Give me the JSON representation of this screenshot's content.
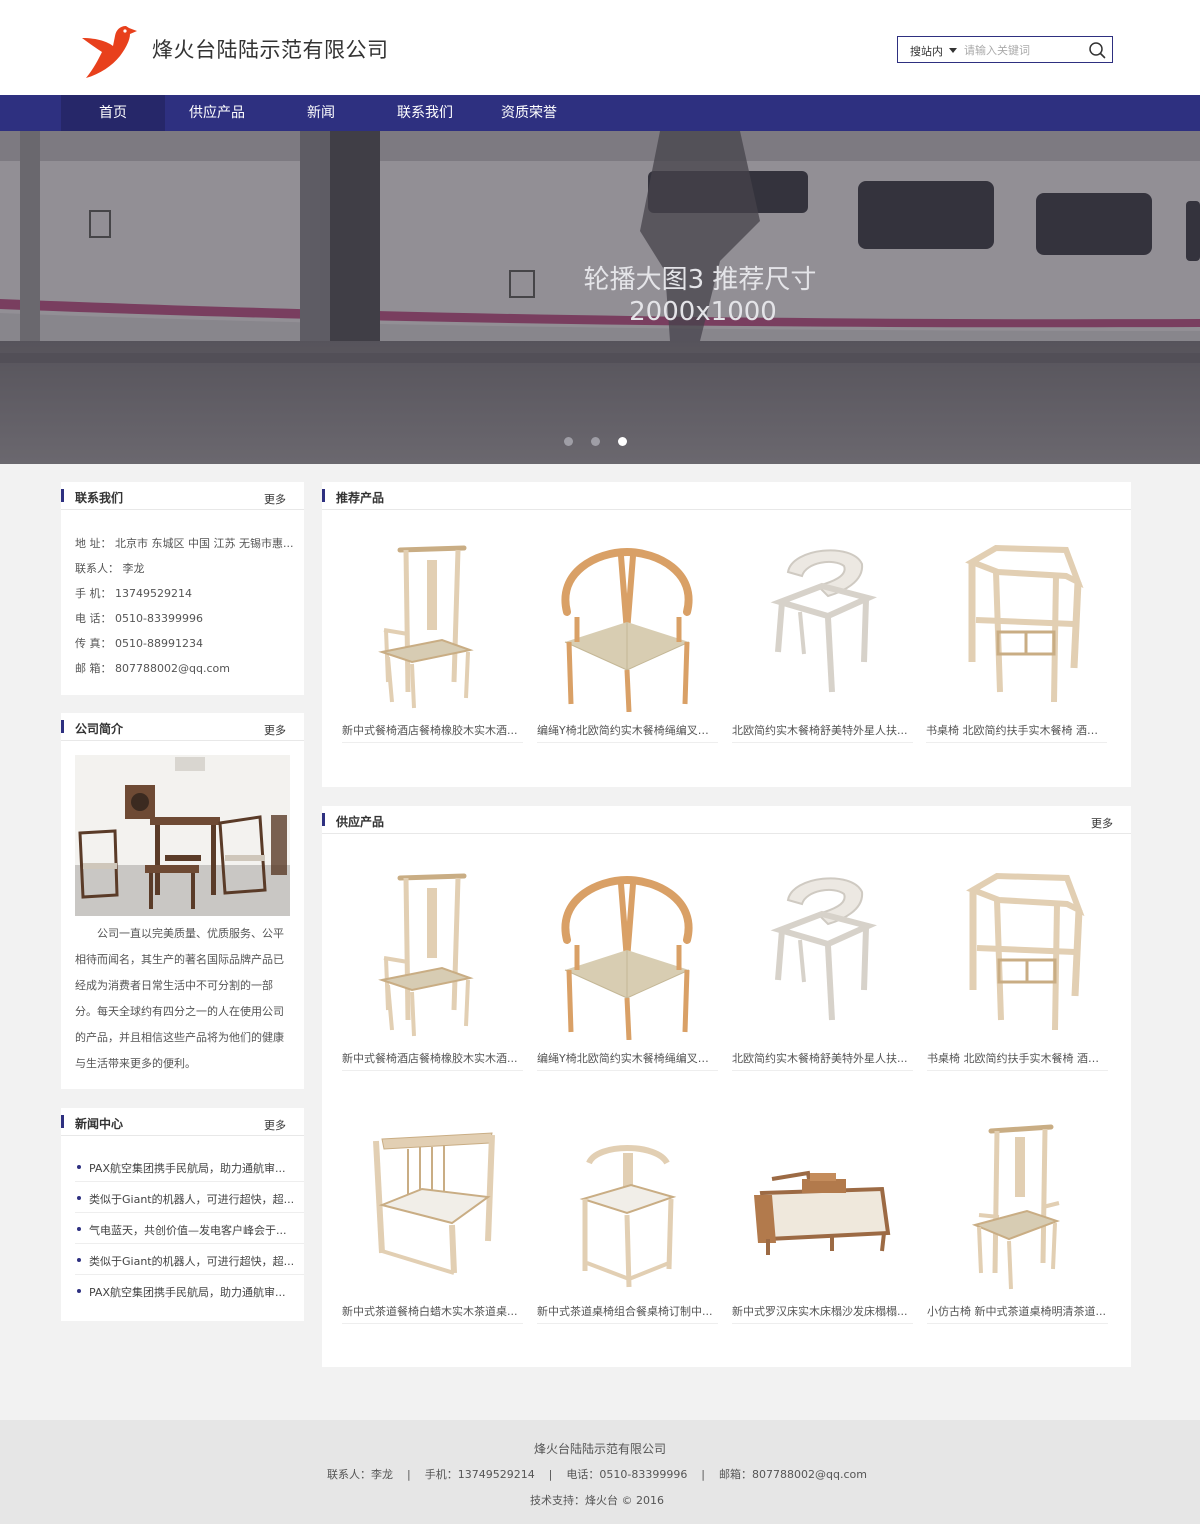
{
  "header": {
    "company_name": "烽火台陆陆示范有限公司",
    "search": {
      "scope": "搜站内",
      "placeholder": "请输入关键词"
    }
  },
  "nav": {
    "items": [
      {
        "label": "首页"
      },
      {
        "label": "供应产品"
      },
      {
        "label": "新闻"
      },
      {
        "label": "联系我们"
      },
      {
        "label": "资质荣誉"
      }
    ]
  },
  "banner": {
    "title": "轮播大图3  推荐尺寸",
    "subtitle": "2000x1000",
    "slide_count": 3,
    "active_slide": 3
  },
  "contact": {
    "title": "联系我们",
    "more": "更多",
    "lines": [
      "地 址： 北京市 东城区 中国 江苏 无锡市惠...",
      "联系人： 李龙",
      "手 机： 13749529214",
      "电 话： 0510-83399996",
      "传 真： 0510-88991234",
      "邮 箱： 807788002@qq.com"
    ]
  },
  "intro": {
    "title": "公司简介",
    "more": "更多",
    "text": "公司一直以完美质量、优质服务、公平相待而闻名，其生产的著名国际品牌产品已经成为消费者日常生活中不可分割的一部分。每天全球约有四分之一的人在使用公司的产品，并且相信这些产品将为他们的健康与生活带来更多的便利。"
  },
  "news": {
    "title": "新闻中心",
    "more": "更多",
    "items": [
      "PAX航空集团携手民航局，助力通航审...",
      "类似于Giant的机器人，可进行超快，超...",
      "气电蓝天，共创价值—发电客户峰会于...",
      "类似于Giant的机器人，可进行超快，超...",
      "PAX航空集团携手民航局，助力通航审..."
    ]
  },
  "recommended": {
    "title": "推荐产品",
    "products": [
      "新中式餐椅酒店餐椅橡胶木实木酒...",
      "编绳Y椅北欧简约实木餐椅绳编叉骨...",
      "北欧简约实木餐椅舒美特外星人扶...",
      "书桌椅 北欧简约扶手实木餐椅 酒店..."
    ]
  },
  "supply": {
    "title": "供应产品",
    "more": "更多",
    "products": [
      "新中式餐椅酒店餐椅橡胶木实木酒...",
      "编绳Y椅北欧简约实木餐椅绳编叉骨...",
      "北欧简约实木餐椅舒美特外星人扶...",
      "书桌椅 北欧简约扶手实木餐椅 酒店...",
      "新中式茶道餐椅白蜡木实木茶道桌...",
      "新中式茶道桌椅组合餐桌椅订制中...",
      "新中式罗汉床实木床榻沙发床榻榻...",
      "小仿古椅 新中式茶道桌椅明清茶道..."
    ]
  },
  "footer": {
    "company": "烽火台陆陆示范有限公司",
    "contact": "联系人：李龙    |    手机：13749529214    |    电话：0510-83399996    |    邮箱：807788002@qq.com",
    "support": "技术支持：烽火台 © 2016"
  },
  "colors": {
    "brand": "#2e3080",
    "logo": "#e8401c",
    "background": "#f2f2f2"
  },
  "icons": {
    "logo": "bird-logo-icon",
    "search": "search-icon",
    "caret": "caret-down-icon"
  }
}
